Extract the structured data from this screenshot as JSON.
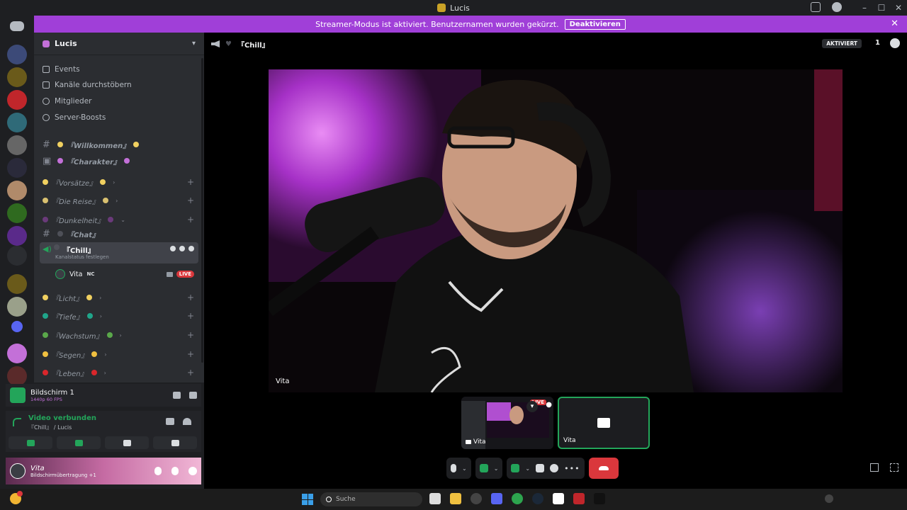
{
  "window": {
    "title": "Lucis"
  },
  "banner": {
    "text": "Streamer-Modus ist aktiviert. Benutzernamen wurden gekürzt.",
    "button": "Deaktivieren"
  },
  "server": {
    "name": "Lucis",
    "nav": [
      "Events",
      "Kanäle durchstöbern",
      "Mitglieder",
      "Server-Boosts"
    ]
  },
  "channels": {
    "willkommen": "『Willkommen』",
    "charakter": "『Charakter』",
    "vorsaetze": "『Vorsätze』",
    "reise": "『Die Reise』",
    "dunkelheit": "『Dunkelheit』",
    "chat": "『Chat』",
    "chill": "『Chill』",
    "chill_status": "Kanalstatus festlegen",
    "licht": "『Licht』",
    "tiefe": "『Tiefe』",
    "wachstum": "『Wachstum』",
    "segen": "『Segen』",
    "leben": "『Leben』"
  },
  "voice_member": {
    "name": "Vita",
    "tag": "NC",
    "live": "LIVE"
  },
  "stream_panel": {
    "name": "Bildschirm 1",
    "meta": "1440p 60 FPS"
  },
  "voice_panel": {
    "state": "Video verbunden",
    "channel": "『Chill』 / Lucis"
  },
  "user_panel": {
    "name": "Vita",
    "status": "Bildschirmübertragung +1"
  },
  "call": {
    "channel": "『Chill』",
    "aktiviert": "AKTIVIERT",
    "participants": "1",
    "stream_owner": "Vita",
    "tile1_label": "Vita",
    "tile2_label": "Vita",
    "tile_live": "LIVE"
  },
  "taskbar": {
    "search_placeholder": "Suche"
  },
  "colors": {
    "accent": "#a03fd8",
    "online": "#23a55a",
    "danger": "#da373c"
  }
}
